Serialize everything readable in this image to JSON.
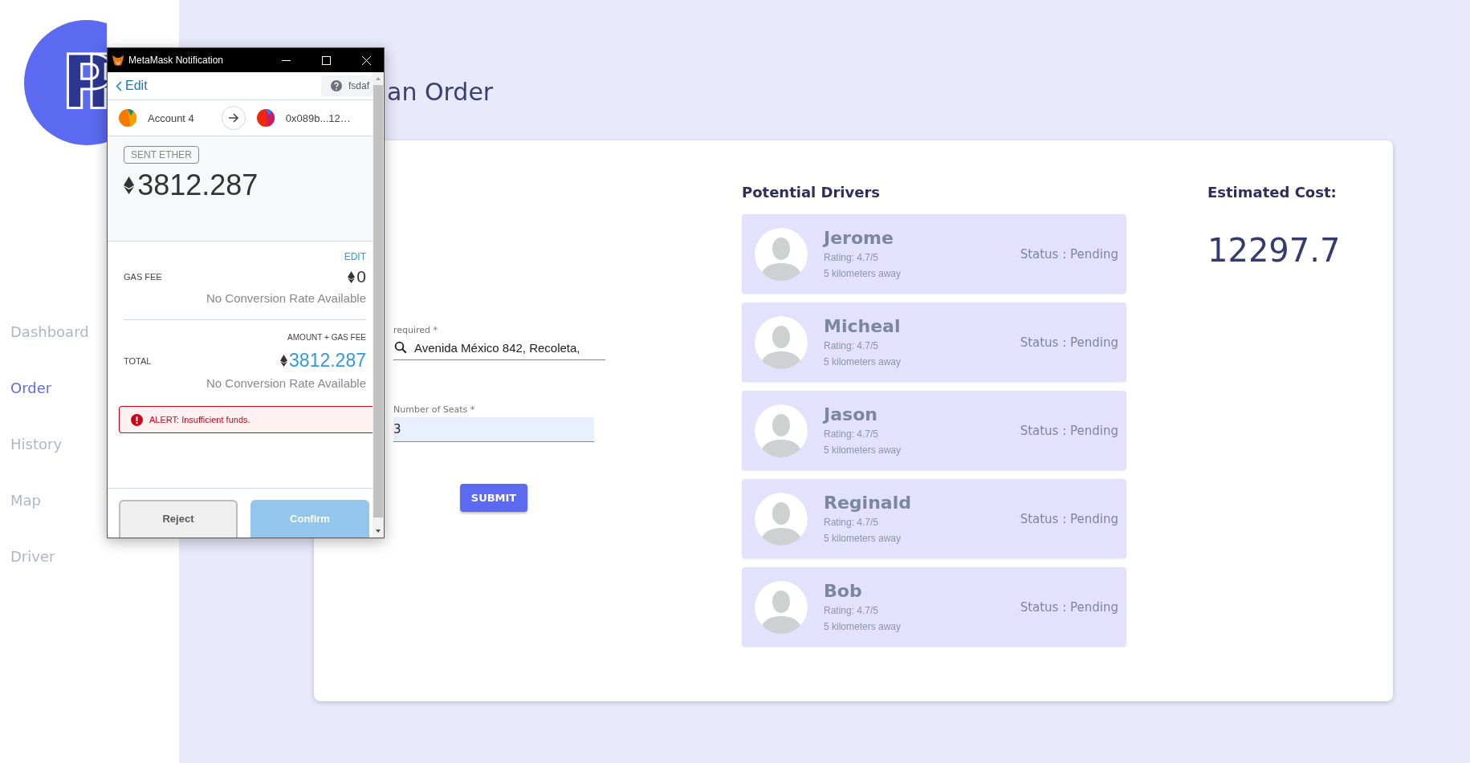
{
  "logo": "PP",
  "sidebar": {
    "items": [
      {
        "label": "Dashboard",
        "selected": false
      },
      {
        "label": "Order",
        "selected": true
      },
      {
        "label": "History",
        "selected": false
      },
      {
        "label": "Map",
        "selected": false
      },
      {
        "label": "Driver",
        "selected": false
      }
    ]
  },
  "page_title": "an Order",
  "order_form": {
    "fields": [
      {
        "kind": "search",
        "label": "required *",
        "value": "Avenida México 842, Recoleta,"
      },
      {
        "kind": "plain",
        "label": "Number of Seats *",
        "value": "3"
      }
    ],
    "submit": "SUBMIT"
  },
  "drivers": {
    "title": "Potential Drivers",
    "items": [
      {
        "name": "Jerome",
        "rating": "Rating: 4.7/5",
        "distance": "5 kilometers away",
        "status": "Status : Pending"
      },
      {
        "name": "Micheal",
        "rating": "Rating: 4.7/5",
        "distance": "5 kilometers away",
        "status": "Status : Pending"
      },
      {
        "name": "Jason",
        "rating": "Rating: 4.7/5",
        "distance": "5 kilometers away",
        "status": "Status : Pending"
      },
      {
        "name": "Reginald",
        "rating": "Rating: 4.7/5",
        "distance": "5 kilometers away",
        "status": "Status : Pending"
      },
      {
        "name": "Bob",
        "rating": "Rating: 4.7/5",
        "distance": "5 kilometers away",
        "status": "Status : Pending"
      }
    ]
  },
  "estimate": {
    "title": "Estimated Cost:",
    "value": "12297.7"
  },
  "popup": {
    "window": {
      "title": "MetaMask Notification"
    },
    "back": "Edit",
    "network": "fsdaf",
    "from": "Account 4",
    "to": "0x089b...12…",
    "badge": "SENT ETHER",
    "amount": "3812.287",
    "gas": {
      "edit": "EDIT",
      "label": "GAS FEE",
      "value": "0",
      "note": "No Conversion Rate Available"
    },
    "total": {
      "caption": "AMOUNT + GAS FEE",
      "label": "TOTAL",
      "value": "3812.287",
      "note": "No Conversion Rate Available"
    },
    "alert": "ALERT: Insufficient funds.",
    "buttons": [
      {
        "label": "Reject",
        "kind": "secondary",
        "disabled": false
      },
      {
        "label": "Confirm",
        "kind": "primary",
        "disabled": true
      }
    ]
  }
}
